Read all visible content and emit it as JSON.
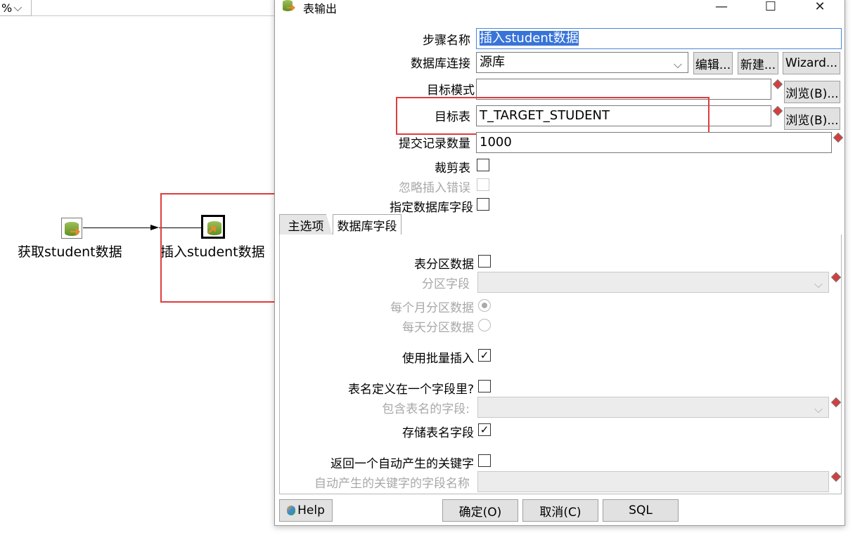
{
  "canvas": {
    "zoom_label": "%",
    "steps": [
      {
        "label": "获取student数据"
      },
      {
        "label": "插入student数据"
      }
    ]
  },
  "dialog": {
    "title": "表输出",
    "window_controls": {
      "minimize": "—",
      "maximize": "☐",
      "close": "✕"
    },
    "fields": {
      "step_name_label": "步骤名称",
      "step_name_value": "插入student数据",
      "db_conn_label": "数据库连接",
      "db_conn_value": "源库",
      "edit_btn": "编辑...",
      "new_btn": "新建...",
      "wizard_btn": "Wizard...",
      "target_schema_label": "目标模式",
      "target_schema_value": "",
      "browse_btn_1": "浏览(B)...",
      "target_table_label": "目标表",
      "target_table_value": "T_TARGET_STUDENT",
      "browse_btn_2": "浏览(B)...",
      "commit_size_label": "提交记录数量",
      "commit_size_value": "1000",
      "truncate_label": "裁剪表",
      "ignore_errors_label": "忽略插入错误",
      "specify_fields_label": "指定数据库字段"
    },
    "tabs": [
      "主选项",
      "数据库字段"
    ],
    "main_options": {
      "partition_label": "表分区数据",
      "partition_field_label": "分区字段",
      "monthly_label": "每个月分区数据",
      "daily_label": "每天分区数据",
      "batch_insert_label": "使用批量插入",
      "batch_insert_checked": true,
      "table_in_field_label": "表名定义在一个字段里?",
      "table_name_field_label": "包含表名的字段:",
      "store_table_name_label": "存储表名字段",
      "store_table_name_checked": true,
      "return_key_label": "返回一个自动产生的关键字",
      "key_field_name_label": "自动产生的关键字的字段名称"
    },
    "footer": {
      "help_btn": "Help",
      "ok_btn": "确定(O)",
      "cancel_btn": "取消(C)",
      "sql_btn": "SQL"
    }
  },
  "colors": {
    "highlight_red": "#e03c3c",
    "selection_blue": "#3874d8",
    "required_marker": "#d83c3c"
  }
}
